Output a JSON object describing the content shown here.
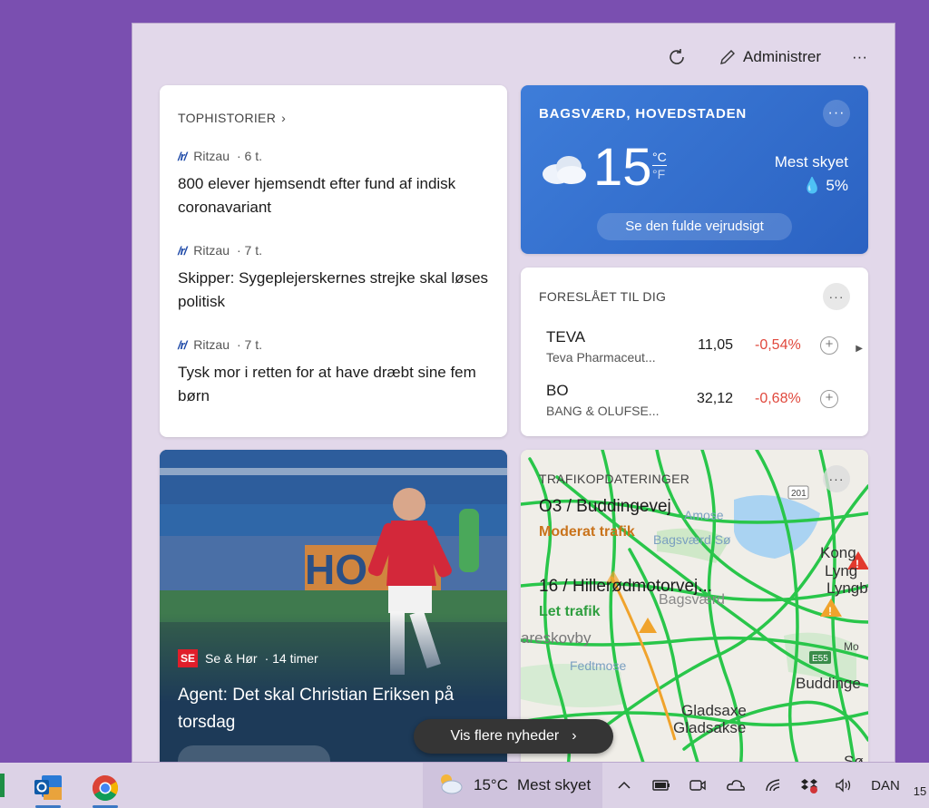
{
  "panel": {
    "refresh_icon": "refresh-icon",
    "manage_label": "Administrer",
    "more_label": "···"
  },
  "top_stories": {
    "header": "TOPHISTORIER",
    "items": [
      {
        "source": "Ritzau",
        "time": "· 6 t.",
        "title": "800 elever hjemsendt efter fund af indisk coronavariant"
      },
      {
        "source": "Ritzau",
        "time": "· 7 t.",
        "title": "Skipper: Sygeplejerskernes strejke skal løses politisk"
      },
      {
        "source": "Ritzau",
        "time": "· 7 t.",
        "title": "Tysk mor i retten for at have dræbt sine fem børn"
      }
    ]
  },
  "weather": {
    "location": "BAGSVÆRD, HOVEDSTADEN",
    "more": "···",
    "temperature": "15",
    "unit_c": "°C",
    "unit_f": "°F",
    "condition": "Mest skyet",
    "precip": "5%",
    "forecast_button": "Se den fulde vejrudsigt"
  },
  "stocks": {
    "header": "FORESLÅET TIL DIG",
    "more": "···",
    "items": [
      {
        "symbol": "TEVA",
        "name": "Teva Pharmaceut...",
        "price": "11,05",
        "change": "-0,54%"
      },
      {
        "symbol": "BO",
        "name": "BANG & OLUFSE...",
        "price": "32,12",
        "change": "-0,68%"
      }
    ]
  },
  "feature": {
    "source": "Se & Hør",
    "source_logo": "SE",
    "time": "· 14 timer",
    "title": "Agent: Det skal Christian Eriksen på torsdag",
    "banner_text": "HO"
  },
  "traffic": {
    "header": "TRAFIKOPDATERINGER",
    "more": "···",
    "routes": [
      {
        "road": "O3 / Buddingevej",
        "status": "Moderat trafik",
        "color": "#c9731b"
      },
      {
        "road": "16 / Hillerødmotorvej...",
        "status": "Let trafik",
        "color": "#2f9e3f"
      }
    ],
    "places": [
      "Amose",
      "Bagsværd Sø",
      "Bagsværd",
      "areskovby",
      "Fedtmose",
      "Gladsaxe",
      "Gladsakse",
      "Kong",
      "Lyng",
      "Lyngb",
      "Buddinge",
      "Mo",
      "Sø"
    ],
    "road_labels": [
      "201",
      "E55"
    ]
  },
  "more_news_button": "Vis flere nyheder",
  "taskbar": {
    "weather_temp": "15°C",
    "weather_cond": "Mest skyet",
    "language": "DAN",
    "clock": "15"
  },
  "colors": {
    "accent": "#3b78c4",
    "negative": "#e0483c",
    "moderate": "#c9731b",
    "light": "#2f9e3f",
    "desktop": "#7a4fb0"
  }
}
